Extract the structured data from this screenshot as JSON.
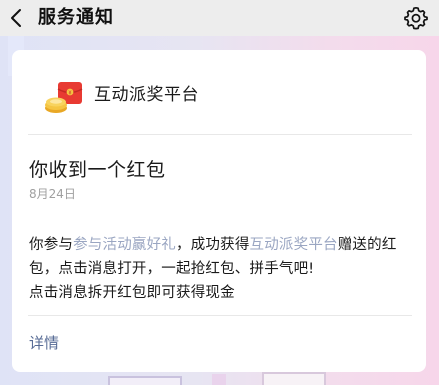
{
  "nav": {
    "title": "服务通知",
    "back_icon": "chevron-left-icon",
    "settings_icon": "gear-icon"
  },
  "card": {
    "app_name": "互动派奖平台",
    "app_icon": "red-envelope-icon",
    "message_title": "你收到一个红包",
    "date": "8月24日",
    "body": {
      "part1": "你参与",
      "link1": "参与活动赢好礼",
      "part2": "，成功获得",
      "link2": "互动派奖平台",
      "part3": "赠送的红包，点击消息打开，一起抢红包、拼手气吧!",
      "line3": "点击消息拆开红包即可获得现金"
    },
    "details_label": "详情"
  },
  "colors": {
    "nav_bg": "#ededed",
    "link": "#576b95",
    "muted_link": "#9aa6c2",
    "envelope_red": "#e83a32",
    "coin_gold": "#f5c542"
  }
}
